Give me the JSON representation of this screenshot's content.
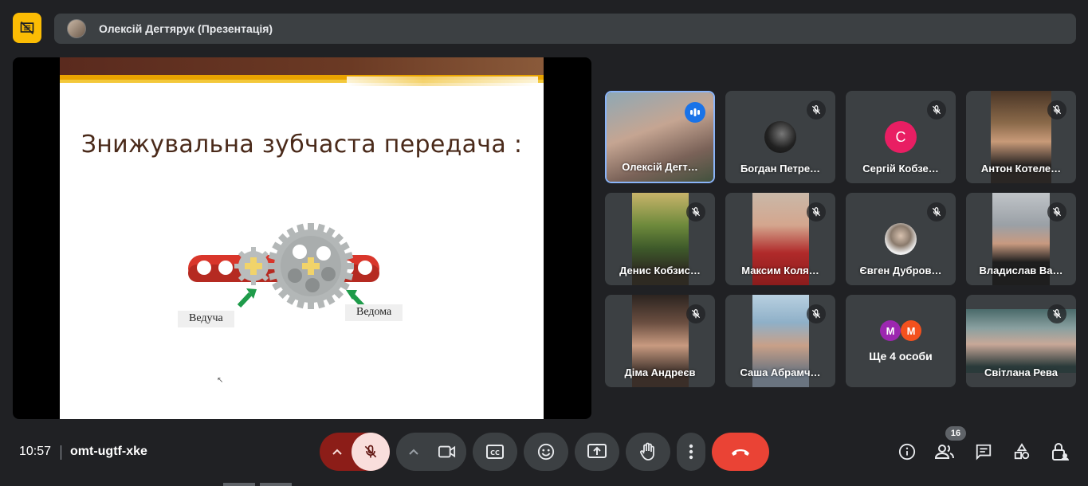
{
  "header": {
    "presenter_title": "Олексій Дегтярук (Презентація)"
  },
  "slide": {
    "title": "Знижувальна зубчаста передача :",
    "label_drive": "Ведуча",
    "label_driven": "Ведома"
  },
  "participants": [
    {
      "name": "Олексій Дегт…",
      "state": "speaking"
    },
    {
      "name": "Богдан Петре…",
      "state": "muted"
    },
    {
      "name": "Сергій Кобзе…",
      "state": "muted",
      "initial": "С",
      "avatar_color": "#e91e63"
    },
    {
      "name": "Антон Котеле…",
      "state": "muted"
    },
    {
      "name": "Денис Кобзис…",
      "state": "muted"
    },
    {
      "name": "Максим Коля…",
      "state": "muted"
    },
    {
      "name": "Євген Дубров…",
      "state": "muted"
    },
    {
      "name": "Владислав Ва…",
      "state": "muted"
    },
    {
      "name": "Діма Андреєв",
      "state": "muted"
    },
    {
      "name": "Саша Абрамч…",
      "state": "muted"
    },
    {
      "name": "Світлана Рева",
      "state": "muted"
    }
  ],
  "more_people": {
    "initials": [
      "М",
      "М"
    ],
    "colors": [
      "#9c27b0",
      "#f4511e"
    ],
    "label": "Ще 4 особи"
  },
  "footer": {
    "time": "10:57",
    "meeting_code": "omt-ugtf-xke",
    "people_count": "16"
  },
  "colors": {
    "accent": "#fbbc04",
    "end_call": "#ea4335",
    "active_speaker": "#8ab4f8"
  }
}
